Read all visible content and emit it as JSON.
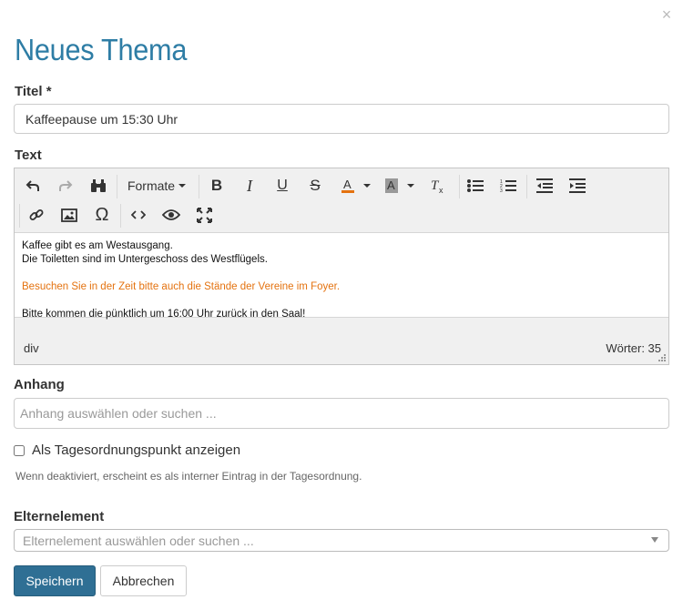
{
  "dialog": {
    "close_label": "×",
    "title": "Neues Thema"
  },
  "form": {
    "title_label": "Titel *",
    "title_value": "Kaffeepause um 15:30 Uhr",
    "text_label": "Text",
    "attachment_label": "Anhang",
    "attachment_placeholder": "Anhang auswählen oder suchen ...",
    "agenda_checkbox_label": "Als Tagesordnungspunkt anzeigen",
    "agenda_checkbox_checked": false,
    "agenda_help": "Wenn deaktiviert, erscheint es als interner Eintrag in der Tagesordnung.",
    "parent_label": "Elternelement",
    "parent_placeholder": "Elternelement auswählen oder suchen ..."
  },
  "editor": {
    "formats_label": "Formate",
    "toolbar_icons": [
      "undo-icon",
      "redo-icon",
      "binoculars-icon",
      "bold-icon",
      "italic-icon",
      "underline-icon",
      "strikethrough-icon",
      "text-color-icon",
      "background-color-icon",
      "clear-formatting-icon",
      "bullet-list-icon",
      "numbered-list-icon",
      "outdent-icon",
      "indent-icon",
      "link-icon",
      "image-icon",
      "omega-icon",
      "code-icon",
      "eye-icon",
      "fullscreen-icon"
    ],
    "lines": [
      "Kaffee gibt es am Westausgang.",
      "Die Toiletten sind im Untergeschoss des Westflügels.",
      "Besuchen Sie in der Zeit bitte auch die Stände der Vereine im Foyer.",
      "Bitte kommen die pünktlich um 16:00 Uhr zurück in den Saal!"
    ],
    "highlight_color": "#e4720f",
    "status_path": "div",
    "word_count_label": "Wörter: 35"
  },
  "buttons": {
    "save": "Speichern",
    "cancel": "Abbrechen"
  },
  "colors": {
    "accent": "#2e7da5",
    "primary_button": "#2f6f94"
  }
}
